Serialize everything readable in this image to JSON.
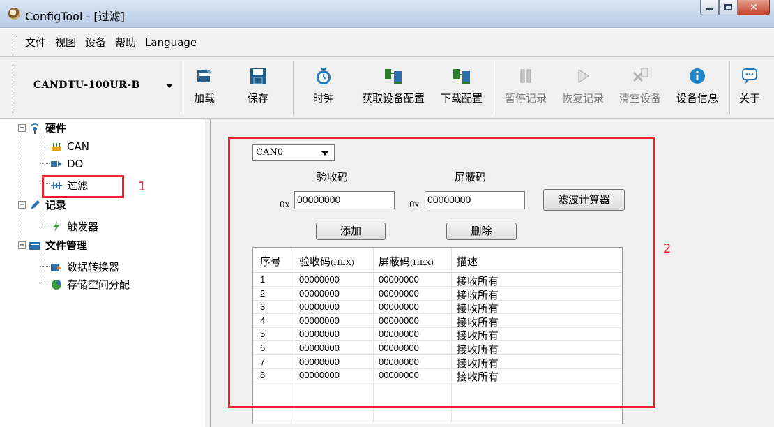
{
  "window": {
    "title": "ConfigTool - [过滤]"
  },
  "menu": [
    "文件",
    "视图",
    "设备",
    "帮助",
    "Language"
  ],
  "toolbar": {
    "device": "CANDTU-100UR-B",
    "buttons": [
      {
        "label": "加载",
        "icon": "load-icon",
        "enabled": true
      },
      {
        "label": "保存",
        "icon": "save-icon",
        "enabled": true
      },
      {
        "label": "时钟",
        "icon": "clock-icon",
        "enabled": true
      },
      {
        "label": "获取设备配置",
        "icon": "get-config-icon",
        "enabled": true
      },
      {
        "label": "下载配置",
        "icon": "download-config-icon",
        "enabled": true
      },
      {
        "label": "暂停记录",
        "icon": "pause-icon",
        "enabled": false
      },
      {
        "label": "恢复记录",
        "icon": "resume-icon",
        "enabled": false
      },
      {
        "label": "清空设备",
        "icon": "clear-device-icon",
        "enabled": false
      },
      {
        "label": "设备信息",
        "icon": "info-icon",
        "enabled": true
      },
      {
        "label": "关于",
        "icon": "about-icon",
        "enabled": true
      }
    ]
  },
  "tree": {
    "hardware": "硬件",
    "can": "CAN",
    "do": "DO",
    "filter": "过滤",
    "record": "记录",
    "trigger": "触发器",
    "file_mgmt": "文件管理",
    "converter": "数据转换器",
    "storage": "存储空间分配"
  },
  "filter": {
    "channel": "CAN0",
    "accept_label": "验收码",
    "mask_label": "屏蔽码",
    "hex_prefix": "0x",
    "accept_value": "00000000",
    "mask_value": "00000000",
    "calc_button": "滤波计算器",
    "add_button": "添加",
    "delete_button": "删除",
    "columns": {
      "index": "序号",
      "accept": "验收码",
      "mask": "屏蔽码",
      "hex": "(HEX)",
      "desc": "描述"
    },
    "rows": [
      {
        "index": "1",
        "accept": "00000000",
        "mask": "00000000",
        "desc": "接收所有"
      },
      {
        "index": "2",
        "accept": "00000000",
        "mask": "00000000",
        "desc": "接收所有"
      },
      {
        "index": "3",
        "accept": "00000000",
        "mask": "00000000",
        "desc": "接收所有"
      },
      {
        "index": "4",
        "accept": "00000000",
        "mask": "00000000",
        "desc": "接收所有"
      },
      {
        "index": "5",
        "accept": "00000000",
        "mask": "00000000",
        "desc": "接收所有"
      },
      {
        "index": "6",
        "accept": "00000000",
        "mask": "00000000",
        "desc": "接收所有"
      },
      {
        "index": "7",
        "accept": "00000000",
        "mask": "00000000",
        "desc": "接收所有"
      },
      {
        "index": "8",
        "accept": "00000000",
        "mask": "00000000",
        "desc": "接收所有"
      }
    ]
  },
  "annotations": {
    "label1": "1",
    "label2": "2",
    "color": "#e8232d"
  }
}
